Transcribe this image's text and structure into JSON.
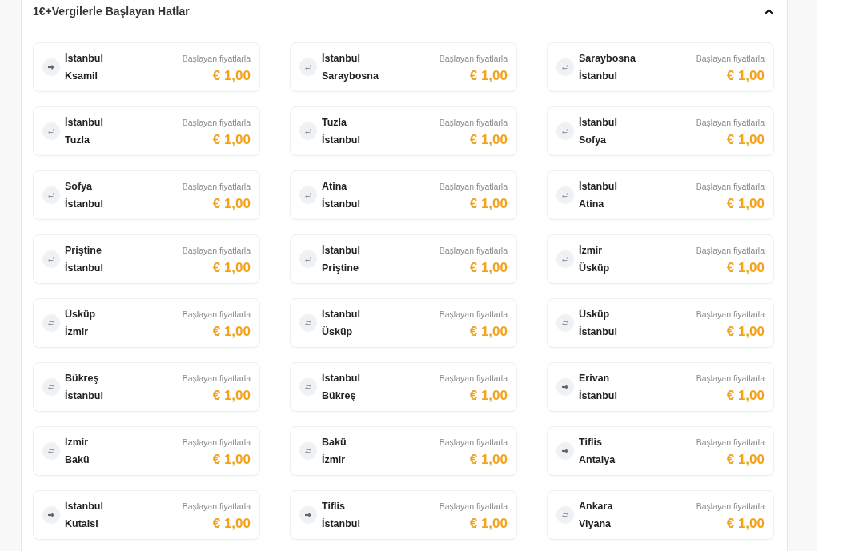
{
  "section": {
    "title": "1€+Vergilerle Başlayan Hatlar",
    "expanded": true
  },
  "routes": [
    {
      "kind": "one_way",
      "from": "İstanbul",
      "to": "Ksamil",
      "price_label": "Başlayan fiyatlarla",
      "price": "€ 1,00"
    },
    {
      "kind": "round_trip",
      "from": "İstanbul",
      "to": "Saraybosna",
      "price_label": "Başlayan fiyatlarla",
      "price": "€ 1,00"
    },
    {
      "kind": "round_trip",
      "from": "Saraybosna",
      "to": "İstanbul",
      "price_label": "Başlayan fiyatlarla",
      "price": "€ 1,00"
    },
    {
      "kind": "round_trip",
      "from": "İstanbul",
      "to": "Tuzla",
      "price_label": "Başlayan fiyatlarla",
      "price": "€ 1,00"
    },
    {
      "kind": "round_trip",
      "from": "Tuzla",
      "to": "İstanbul",
      "price_label": "Başlayan fiyatlarla",
      "price": "€ 1,00"
    },
    {
      "kind": "round_trip",
      "from": "İstanbul",
      "to": "Sofya",
      "price_label": "Başlayan fiyatlarla",
      "price": "€ 1,00"
    },
    {
      "kind": "round_trip",
      "from": "Sofya",
      "to": "İstanbul",
      "price_label": "Başlayan fiyatlarla",
      "price": "€ 1,00"
    },
    {
      "kind": "round_trip",
      "from": "Atina",
      "to": "İstanbul",
      "price_label": "Başlayan fiyatlarla",
      "price": "€ 1,00"
    },
    {
      "kind": "round_trip",
      "from": "İstanbul",
      "to": "Atina",
      "price_label": "Başlayan fiyatlarla",
      "price": "€ 1,00"
    },
    {
      "kind": "round_trip",
      "from": "Priştine",
      "to": "İstanbul",
      "price_label": "Başlayan fiyatlarla",
      "price": "€ 1,00"
    },
    {
      "kind": "round_trip",
      "from": "İstanbul",
      "to": "Priştine",
      "price_label": "Başlayan fiyatlarla",
      "price": "€ 1,00"
    },
    {
      "kind": "round_trip",
      "from": "İzmir",
      "to": "Üsküp",
      "price_label": "Başlayan fiyatlarla",
      "price": "€ 1,00"
    },
    {
      "kind": "round_trip",
      "from": "Üsküp",
      "to": "İzmir",
      "price_label": "Başlayan fiyatlarla",
      "price": "€ 1,00"
    },
    {
      "kind": "round_trip",
      "from": "İstanbul",
      "to": "Üsküp",
      "price_label": "Başlayan fiyatlarla",
      "price": "€ 1,00"
    },
    {
      "kind": "round_trip",
      "from": "Üsküp",
      "to": "İstanbul",
      "price_label": "Başlayan fiyatlarla",
      "price": "€ 1,00"
    },
    {
      "kind": "round_trip",
      "from": "Bükreş",
      "to": "İstanbul",
      "price_label": "Başlayan fiyatlarla",
      "price": "€ 1,00"
    },
    {
      "kind": "round_trip",
      "from": "İstanbul",
      "to": "Bükreş",
      "price_label": "Başlayan fiyatlarla",
      "price": "€ 1,00"
    },
    {
      "kind": "one_way",
      "from": "Erivan",
      "to": "İstanbul",
      "price_label": "Başlayan fiyatlarla",
      "price": "€ 1,00"
    },
    {
      "kind": "round_trip",
      "from": "İzmir",
      "to": "Bakü",
      "price_label": "Başlayan fiyatlarla",
      "price": "€ 1,00"
    },
    {
      "kind": "round_trip",
      "from": "Bakü",
      "to": "İzmir",
      "price_label": "Başlayan fiyatlarla",
      "price": "€ 1,00"
    },
    {
      "kind": "one_way",
      "from": "Tiflis",
      "to": "Antalya",
      "price_label": "Başlayan fiyatlarla",
      "price": "€ 1,00"
    },
    {
      "kind": "one_way",
      "from": "İstanbul",
      "to": "Kutaisi",
      "price_label": "Başlayan fiyatlarla",
      "price": "€ 1,00"
    },
    {
      "kind": "one_way",
      "from": "Tiflis",
      "to": "İstanbul",
      "price_label": "Başlayan fiyatlarla",
      "price": "€ 1,00"
    },
    {
      "kind": "round_trip",
      "from": "Ankara",
      "to": "Viyana",
      "price_label": "Başlayan fiyatlarla",
      "price": "€ 1,00"
    }
  ]
}
